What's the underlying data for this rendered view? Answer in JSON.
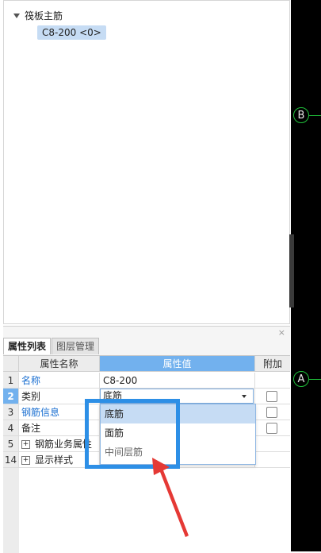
{
  "tree": {
    "root_label": "筏板主筋",
    "child_label": "C8-200 <0>"
  },
  "canvas": {
    "axis_b": "B",
    "axis_a": "A"
  },
  "panel": {
    "close_glyph": "×",
    "tabs": [
      "属性列表",
      "图层管理"
    ],
    "columns": {
      "name": "属性名称",
      "value": "属性值",
      "extra": "附加"
    },
    "rows": [
      {
        "num": "1",
        "name": "名称",
        "value": "C8-200"
      },
      {
        "num": "2",
        "name": "类别",
        "value": "底筋"
      },
      {
        "num": "3",
        "name": "钢筋信息",
        "value": ""
      },
      {
        "num": "4",
        "name": "备注",
        "value": ""
      },
      {
        "num": "5",
        "name": "钢筋业务属性",
        "value": ""
      },
      {
        "num": "14",
        "name": "显示样式",
        "value": ""
      }
    ],
    "plus_glyph": "+"
  },
  "dropdown": {
    "options": [
      "底筋",
      "面筋",
      "中间层筋"
    ],
    "selected": "底筋"
  },
  "colors": {
    "header_blue": "#72b1ee",
    "highlight_blue": "#2d8fe6",
    "arrow_red": "#e53935",
    "axis_green": "#1fbf3a"
  }
}
